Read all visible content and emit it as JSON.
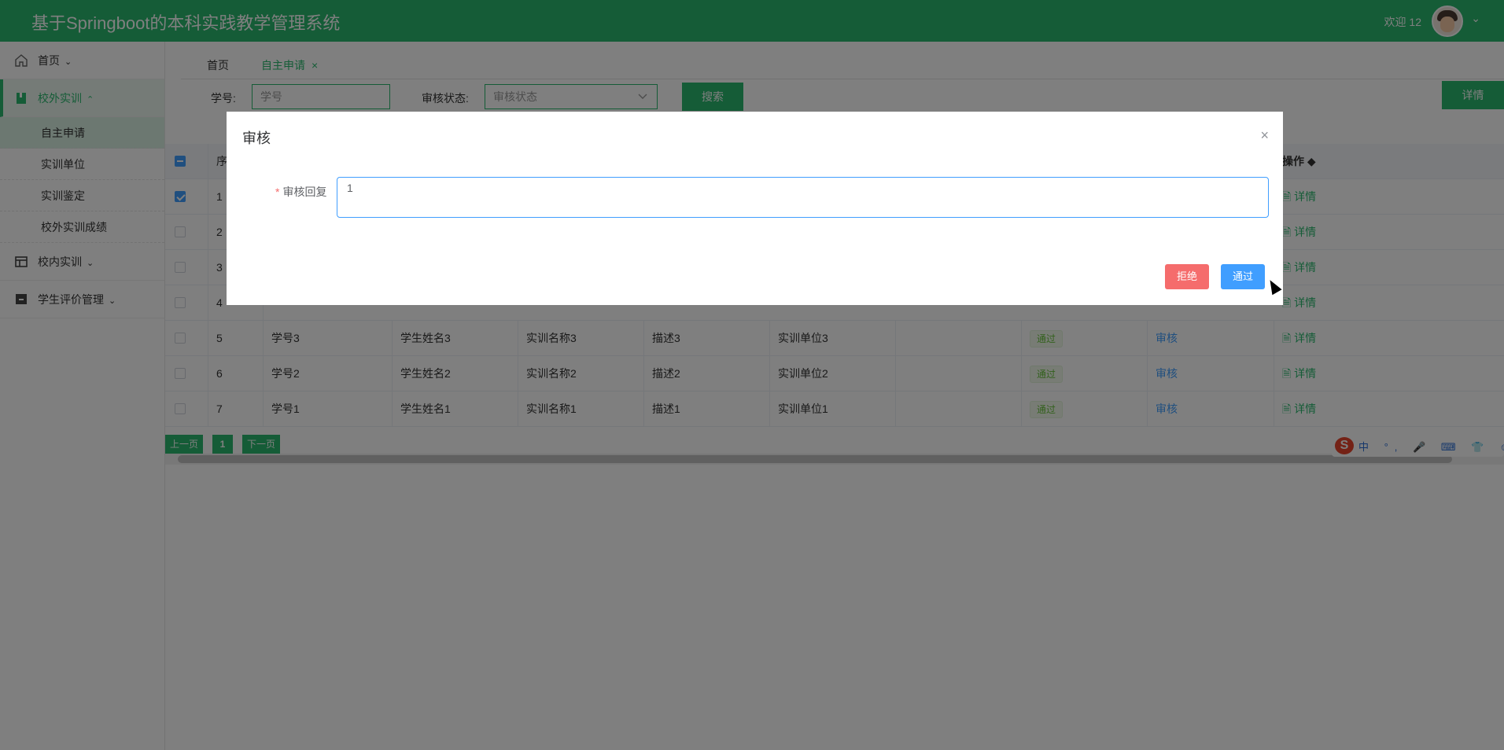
{
  "header": {
    "title": "基于Springboot的本科实践教学管理系统",
    "welcome": "欢迎 12",
    "chevron": "⌄"
  },
  "sidebar": {
    "items": [
      {
        "label": "首页",
        "icon": "home-icon",
        "arrow": "⌄"
      },
      {
        "label": "校外实训",
        "icon": "book-icon",
        "arrow": "⌃"
      },
      {
        "label": "校内实训",
        "icon": "table-icon",
        "arrow": "⌄"
      },
      {
        "label": "学生评价管理",
        "icon": "box-icon",
        "arrow": "⌄"
      }
    ],
    "subitems": [
      "自主申请",
      "实训单位",
      "实训鉴定",
      "校外实训成绩"
    ]
  },
  "tabs": {
    "home": "首页",
    "current": "自主申请",
    "close": "×"
  },
  "search": {
    "id_label": "学号:",
    "id_placeholder": "学号",
    "status_label": "审核状态:",
    "status_placeholder": "审核状态",
    "search_button": "搜索",
    "detail_button": "详情"
  },
  "table": {
    "header": {
      "seq": "序",
      "op": "操作 ◆"
    },
    "rows": [
      {
        "seq": "1",
        "checked": true
      },
      {
        "seq": "2"
      },
      {
        "seq": "3"
      },
      {
        "seq": "4"
      },
      {
        "seq": "5",
        "id": "学号3",
        "name": "学生姓名3",
        "course": "实训名称3",
        "desc": "描述3",
        "unit": "实训单位3",
        "status": "通过",
        "audit": "审核",
        "detail": "详情"
      },
      {
        "seq": "6",
        "id": "学号2",
        "name": "学生姓名2",
        "course": "实训名称2",
        "desc": "描述2",
        "unit": "实训单位2",
        "status": "通过",
        "audit": "审核",
        "detail": "详情"
      },
      {
        "seq": "7",
        "id": "学号1",
        "name": "学生姓名1",
        "course": "实训名称1",
        "desc": "描述1",
        "unit": "实训单位1",
        "status": "通过",
        "audit": "审核",
        "detail": "详情"
      }
    ],
    "detail_label": "详情"
  },
  "pager": {
    "prev": "上一页",
    "page": "1",
    "next": "下一页"
  },
  "ime": {
    "logo": "S",
    "items": "中 °, 🎤 ⌨ 👕 ☺ ▦ ⚙"
  },
  "modal": {
    "title": "审核",
    "close": "×",
    "field_label": "审核回复",
    "required": "*",
    "reply_value": "1",
    "reject_button": "拒绝",
    "pass_button": "通过"
  },
  "colors": {
    "primary_green": "#2ab96e",
    "blue": "#409eff",
    "red": "#f56c6c"
  }
}
